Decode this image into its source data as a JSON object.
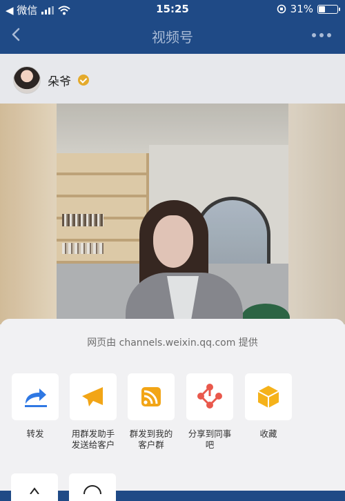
{
  "status_bar": {
    "back_app": "◀ 微信",
    "time": "15:25",
    "battery_percent": "31%",
    "battery_level": 0.31
  },
  "nav": {
    "title": "视频号"
  },
  "author": {
    "name": "朵爷"
  },
  "share_sheet": {
    "source_text": "网页由 channels.weixin.qq.com 提供",
    "actions": [
      {
        "label": "转发",
        "icon": "forward-icon"
      },
      {
        "label": "用群发助手发送给客户",
        "icon": "mass-send-icon"
      },
      {
        "label": "群发到我的客户群",
        "icon": "rss-icon"
      },
      {
        "label": "分享到同事吧",
        "icon": "colleague-share-icon"
      },
      {
        "label": "收藏",
        "icon": "favorite-cube-icon"
      }
    ],
    "colors": {
      "forward": "#2f78e3",
      "mass_send": "#f2a516",
      "rss": "#f2a516",
      "colleague": "#e9584c",
      "favorite": "#f5b21a"
    }
  }
}
